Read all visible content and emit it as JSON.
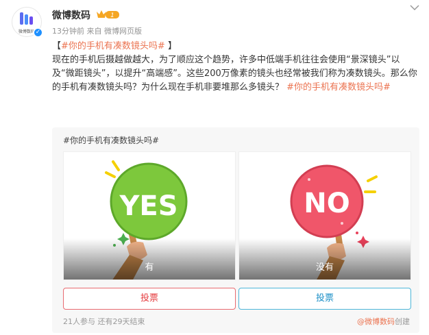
{
  "author": {
    "name": "微博数码",
    "avatar_text": "微博数码",
    "vip_level": "1",
    "time": "13分钟前",
    "source": "来自 微博网页版"
  },
  "post": {
    "title_prefix": "【",
    "title_topic": "#你的手机有凑数镜头吗#",
    "title_suffix": " 】",
    "body": "现在的手机后摄越做越大，为了顺应这个趋势，许多中低端手机往往会使用“景深镜头”以及“微距镜头”，以提升“高端感”。这些200万像素的镜头也经常被我们称为凑数镜头。那么你的手机有凑数镜头吗？为什么现在手机非要堆那么多镜头？ ",
    "body_topic": "#你的手机有凑数镜头吗#"
  },
  "vote": {
    "title": "#你的手机有凑数镜头吗#",
    "options": [
      {
        "label": "有",
        "sign_text": "YES",
        "button": "投票"
      },
      {
        "label": "没有",
        "sign_text": "NO",
        "button": "投票"
      }
    ],
    "participants": "21人参与",
    "remaining": "还有29天结束",
    "creator_link": "@微博数码",
    "creator_suffix": "创建"
  },
  "colors": {
    "topic": "#eb7350",
    "yes_sign": "#7dc83c",
    "no_sign": "#f0566a",
    "red_button": "#e4393c",
    "blue_button": "#1b8fc7"
  }
}
